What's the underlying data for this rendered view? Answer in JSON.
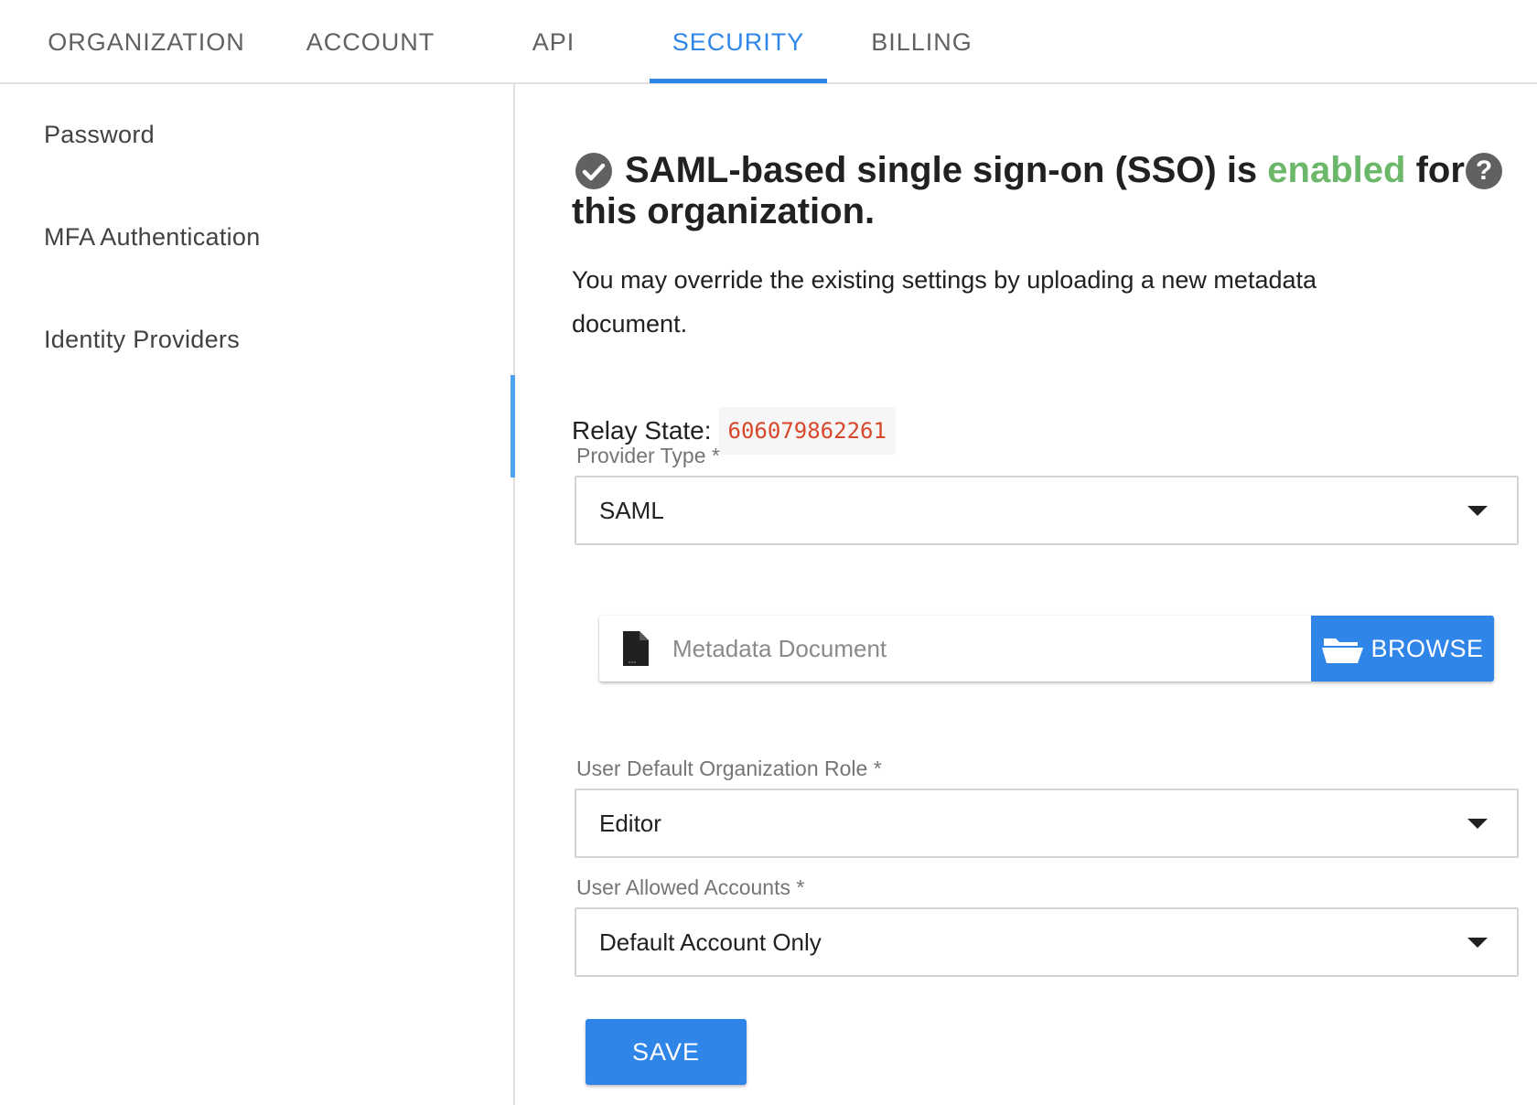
{
  "tabs": [
    {
      "label": "ORGANIZATION"
    },
    {
      "label": "ACCOUNT"
    },
    {
      "label": "API"
    },
    {
      "label": "SECURITY",
      "active": true
    },
    {
      "label": "BILLING"
    }
  ],
  "sidebar": {
    "items": [
      {
        "label": "Password"
      },
      {
        "label": "MFA Authentication"
      },
      {
        "label": "Identity Providers",
        "active": true
      }
    ]
  },
  "main": {
    "headline_part1": "SAML-based single sign-on (SSO) is",
    "headline_status": "enabled",
    "headline_part2": "for this organization.",
    "description": "You may override the existing settings by uploading a new metadata document.",
    "relay_state_label": "Relay State:",
    "relay_state_value": "606079862261",
    "provider_type": {
      "label": "Provider Type *",
      "value": "SAML"
    },
    "metadata": {
      "placeholder": "Metadata Document",
      "browse_label": "BROWSE"
    },
    "default_role": {
      "label": "User Default Organization Role *",
      "value": "Editor"
    },
    "allowed_accounts": {
      "label": "User Allowed Accounts *",
      "value": "Default Account Only"
    },
    "save_label": "SAVE",
    "help_glyph": "?"
  },
  "colors": {
    "accent": "#2f86e8",
    "enabled": "#6cb86a",
    "relay_value": "#d9472b"
  },
  "icons": {
    "status": "check-circle-icon",
    "help": "help-icon",
    "file": "file-icon",
    "browse": "folder-open-icon",
    "dropdown": "caret-down-icon"
  }
}
